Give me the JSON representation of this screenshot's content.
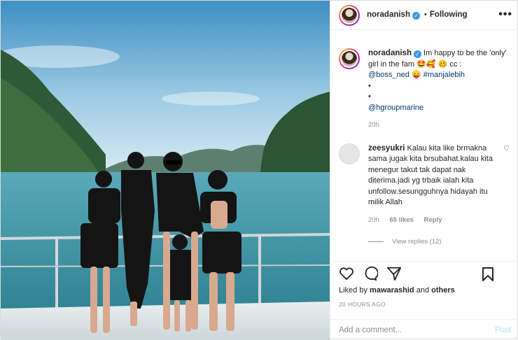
{
  "header": {
    "username": "noradanish",
    "verified_mark": "✓",
    "separator": "•",
    "follow_label": "Following",
    "more_label": "•••"
  },
  "caption": {
    "username": "noradanish",
    "text_part1": "Im happy to be the 'only' girl in the fam",
    "emoji1": "🤩🥰",
    "emoji2": "🥴",
    "cc": "cc :",
    "mention": "@boss_ned",
    "emoji3": "😛",
    "hashtag": "#manjalebih",
    "bullet1": "•",
    "bullet2": "•",
    "mention2": "@hgroupmarine",
    "time": "20h"
  },
  "comment": {
    "username": "zeesyukri",
    "text": "Kalau kita like brmakna sama jugak kita brsubahat.kalau kita menegur takut tak dapat nak diterima.jadi yg trbaik ialah kita unfollow.sesungguhnya hidayah itu milik Allah",
    "time": "20h",
    "likes": "65 likes",
    "reply": "Reply",
    "view_replies": "View replies (12)"
  },
  "actions": {
    "liked_prefix": "Liked by",
    "liked_user": "mawarashid",
    "liked_and": "and",
    "liked_others": "others",
    "timestamp": "20 HOURS AGO"
  },
  "add_comment": {
    "placeholder": "Add a comment...",
    "post_label": "Post"
  },
  "colors": {
    "link": "#00376b",
    "verified": "#3897f0",
    "post_button": "#b2dffc",
    "muted": "#8e8e8e"
  }
}
